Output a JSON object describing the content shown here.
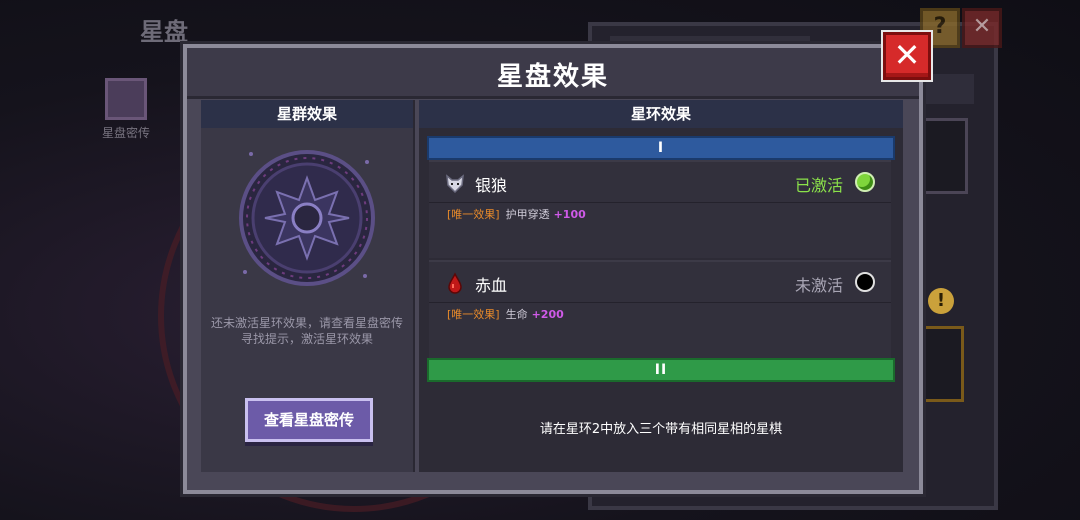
{
  "background": {
    "title": "星盘",
    "tome_label": "星盘密传"
  },
  "modal": {
    "title": "星盘效果",
    "close_label": "✕"
  },
  "left_panel": {
    "header": "星群效果",
    "hint": "还未激活星环效果，请查看星盘密传寻找提示，激活星环效果",
    "button_label": "查看星盘密传"
  },
  "right_panel": {
    "header": "星环效果",
    "ring1_label": "I",
    "ring2_label": "II",
    "effects": [
      {
        "name": "银狼",
        "icon": "silver-wolf-icon",
        "status": "已激活",
        "active": true,
        "tag": "[唯一效果]",
        "stat": "护甲穿透",
        "value": "+100"
      },
      {
        "name": "赤血",
        "icon": "red-blood-icon",
        "status": "未激活",
        "active": false,
        "tag": "[唯一效果]",
        "stat": "生命",
        "value": "+200"
      }
    ],
    "ring2_hint": "请在星环2中放入三个带有相同星相的星棋"
  },
  "colors": {
    "active_green": "#8be24a",
    "ring1_blue": "#2e5a9e",
    "ring2_green": "#2f9a48",
    "close_red": "#d62a2a",
    "tag_orange": "#e88a2a",
    "value_purple": "#cf5ae8"
  }
}
